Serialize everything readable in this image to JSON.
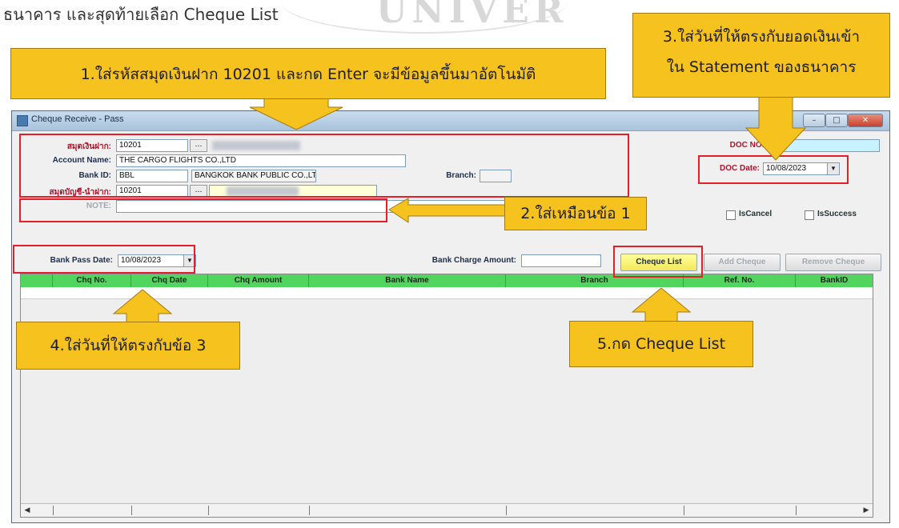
{
  "doc_text": "ธนาคาร และสุดท้ายเลือก Cheque List",
  "watermark": "UNIVER",
  "callouts": {
    "step1": "1.ใส่รหัสสมุดเงินฝาก 10201 และกด Enter จะมีข้อมูลขึ้นมาอัตโนมัติ",
    "step2": "2.ใส่เหมือนข้อ 1",
    "step3_line1": "3.ใส่วันที่ให้ตรงกับยอดเงินเข้า",
    "step3_line2": "ใน Statement ของธนาคาร",
    "step4": "4.ใส่วันที่ให้ตรงกับข้อ 3",
    "step5": "5.กด Cheque List"
  },
  "window": {
    "title": "Cheque Receive - Pass",
    "buttons": {
      "minimize": "–",
      "maximize": "□",
      "close": "✕"
    }
  },
  "form": {
    "passbook_label": "สมุดเงินฝาก:",
    "passbook_value": "10201",
    "account_name_label": "Account Name:",
    "account_name_value": "THE CARGO FLIGHTS CO.,LTD",
    "bank_id_label": "Bank ID:",
    "bank_id_value": "BBL",
    "bank_name_value": "BANGKOK BANK PUBLIC CO.,LTD. ธ.กรุงเทพ",
    "branch_label": "Branch:",
    "pay_account_label": "สมุดบัญชี-นำฝาก:",
    "pay_account_value": "10201",
    "note_label": "NOTE:",
    "doc_no_label": "DOC NO:",
    "doc_no_value": "",
    "doc_date_label": "DOC Date:",
    "doc_date_value": "10/08/2023",
    "is_cancel_label": "IsCancel",
    "is_success_label": "IsSuccess",
    "bank_pass_date_label": "Bank Pass Date:",
    "bank_pass_date_value": "10/08/2023",
    "bank_charge_label": "Bank Charge Amount:",
    "bank_charge_value": ""
  },
  "actions": {
    "cheque_list": "Cheque List",
    "add_cheque": "Add Cheque",
    "remove_cheque": "Remove Cheque"
  },
  "grid": {
    "columns": [
      "Chq No.",
      "Chq Date",
      "Chq Amount",
      "Bank Name",
      "Branch",
      "Ref. No.",
      "BankID"
    ]
  },
  "colors": {
    "callout": "#f6c21d",
    "highlight_border": "#e3202a",
    "grid_header": "#52d55f",
    "label_red": "#b3122b"
  }
}
